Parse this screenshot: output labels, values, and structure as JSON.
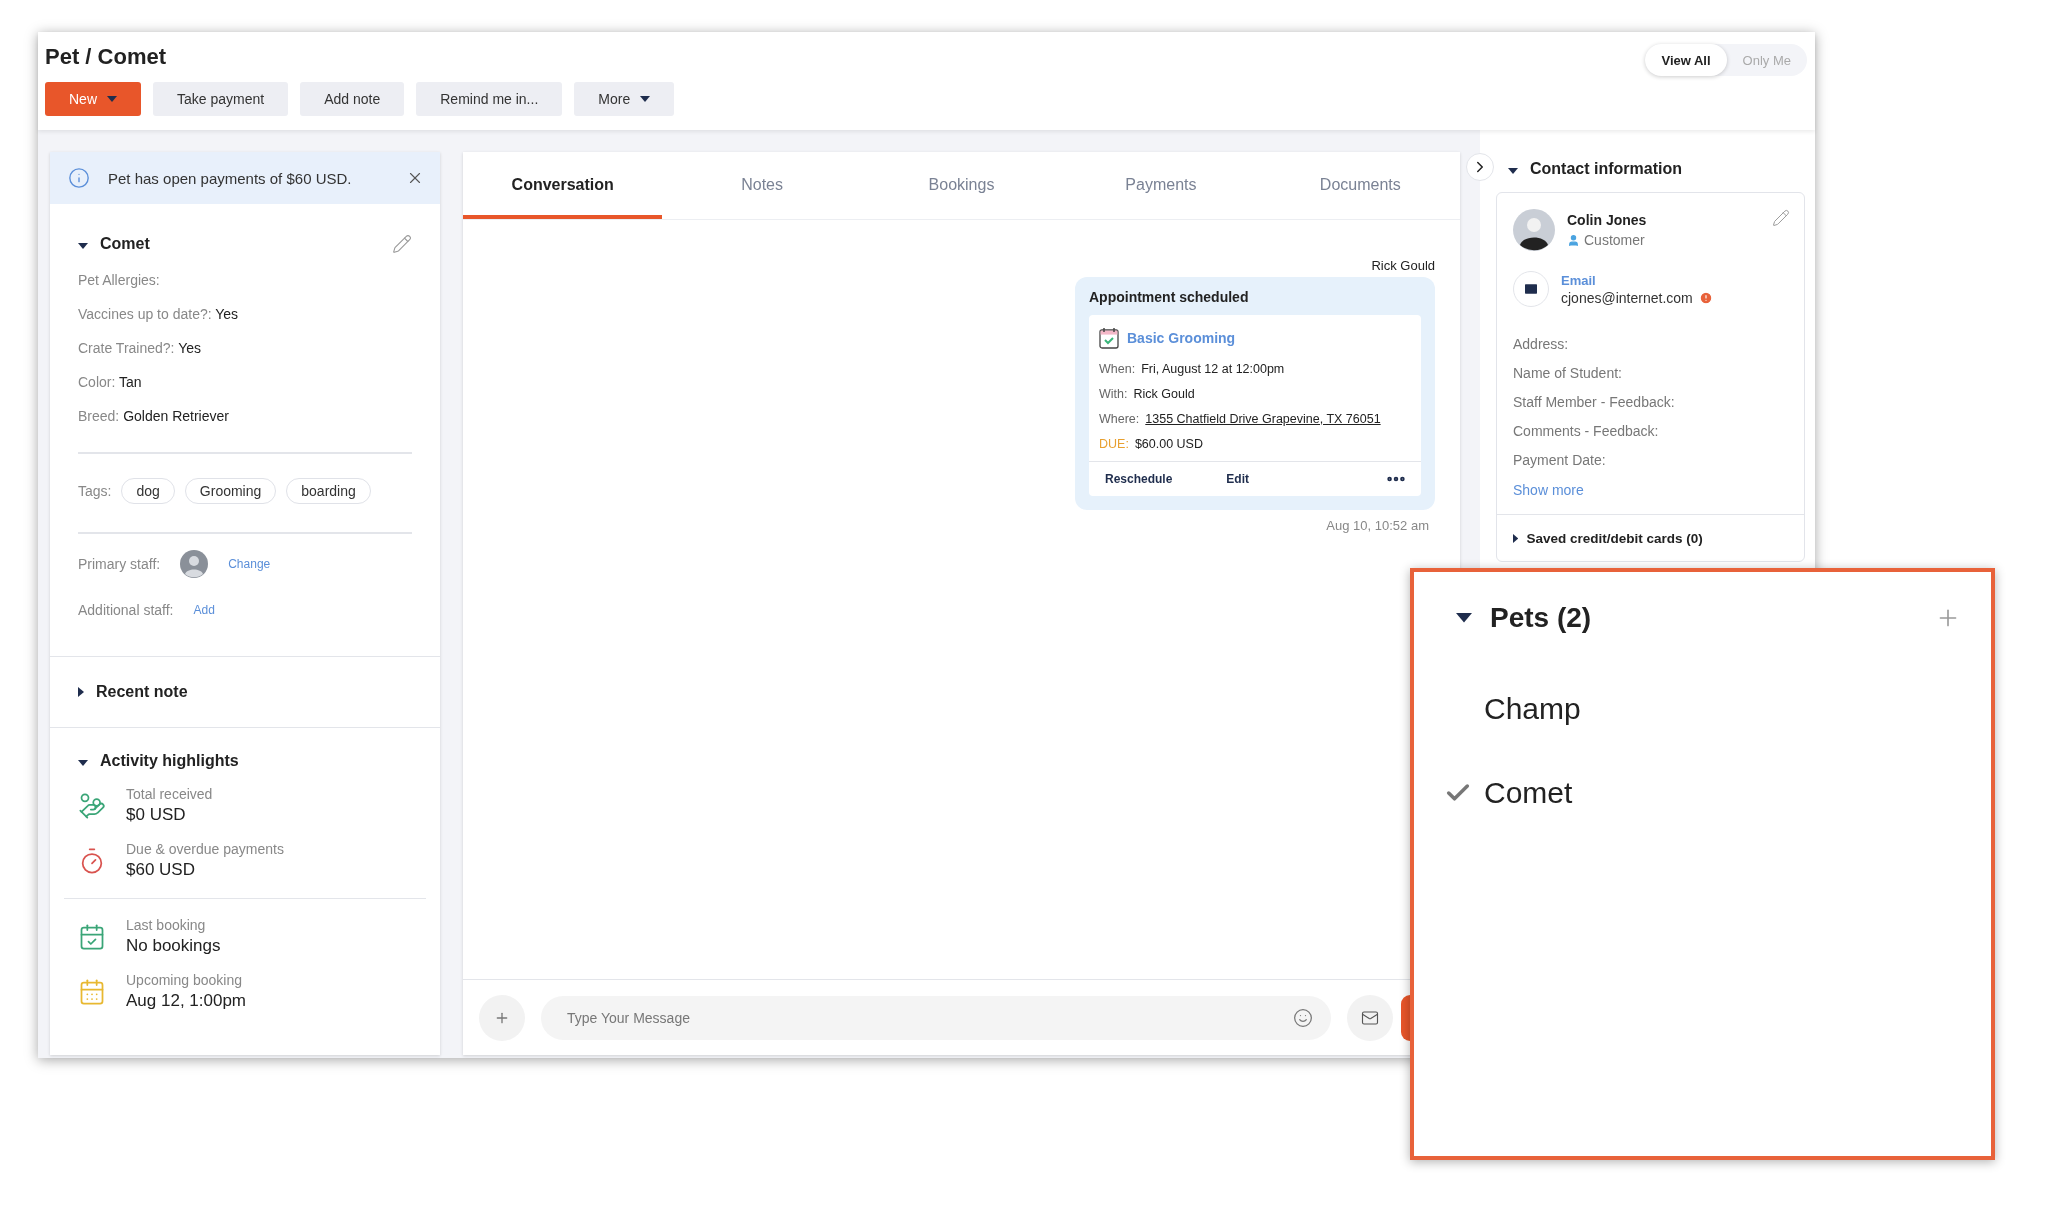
{
  "header": {
    "title": "Pet / Comet",
    "actions": [
      {
        "label": "New",
        "kind": "primary",
        "dropdown": true
      },
      {
        "label": "Take payment",
        "kind": "secondary",
        "dropdown": false
      },
      {
        "label": "Add note",
        "kind": "secondary",
        "dropdown": false
      },
      {
        "label": "Remind me in...",
        "kind": "secondary",
        "dropdown": false
      },
      {
        "label": "More",
        "kind": "secondary",
        "dropdown": true
      }
    ],
    "view_toggle": [
      {
        "label": "View All",
        "selected": true
      },
      {
        "label": "Only Me",
        "selected": false
      }
    ]
  },
  "alert": {
    "text": "Pet has open payments of $60 USD."
  },
  "pet": {
    "name": "Comet",
    "expanded": true,
    "fields": [
      {
        "label": "Pet Allergies:"
      },
      {
        "label": "Vaccines up to date?:",
        "value": "Yes"
      },
      {
        "label": "Crate Trained?:",
        "value": "Yes"
      },
      {
        "label": "Color:",
        "value": "Tan"
      },
      {
        "label": "Breed:",
        "value": "Golden Retriever"
      }
    ]
  },
  "tags": {
    "label": "Tags:",
    "items": [
      "dog",
      "Grooming",
      "boarding"
    ]
  },
  "staff": [
    {
      "label": "Primary staff:",
      "has_avatar": true,
      "action": "Change"
    },
    {
      "label": "Additional staff:",
      "has_avatar": false,
      "action": "Add"
    }
  ],
  "recent_note": {
    "title": "Recent note",
    "expanded": false
  },
  "activity": {
    "title": "Activity highlights",
    "expanded": true,
    "groups": [
      [
        {
          "kind": "received",
          "label": "Total received",
          "value": "$0 USD"
        },
        {
          "kind": "due",
          "label": "Due & overdue payments",
          "value": "$60 USD"
        }
      ],
      [
        {
          "kind": "last_booking",
          "label": "Last booking",
          "value": "No bookings"
        },
        {
          "kind": "upcoming",
          "label": "Upcoming booking",
          "value": "Aug 12, 1:00pm"
        }
      ]
    ]
  },
  "tabs": [
    {
      "label": "Conversation",
      "selected": true
    },
    {
      "label": "Notes",
      "selected": false
    },
    {
      "label": "Bookings",
      "selected": false
    },
    {
      "label": "Payments",
      "selected": false
    },
    {
      "label": "Documents",
      "selected": false
    }
  ],
  "conversation": {
    "sender": "Rick Gould",
    "title": "Appointment scheduled",
    "service": "Basic Grooming",
    "details": [
      {
        "kind": "plain",
        "label": "When:",
        "value": "Fri, August 12 at 12:00pm"
      },
      {
        "kind": "plain",
        "label": "With:",
        "value": "Rick Gould"
      },
      {
        "kind": "link",
        "label": "Where:",
        "value": "1355 Chatfield Drive Grapevine, TX 76051"
      },
      {
        "kind": "due",
        "label": "DUE:",
        "value": "$60.00 USD"
      }
    ],
    "actions": [
      "Reschedule",
      "Edit"
    ],
    "time": "Aug 10, 10:52 am"
  },
  "composer": {
    "placeholder": "Type Your Message"
  },
  "contact": {
    "title": "Contact information",
    "expanded": true,
    "name": "Colin Jones",
    "role": "Customer",
    "email_label": "Email",
    "email": "cjones@internet.com",
    "email_warning": true,
    "fields": [
      "Address:",
      "Name of Student:",
      "Staff Member - Feedback:",
      "Comments - Feedback:",
      "Payment Date:"
    ],
    "show_more": "Show more"
  },
  "saved_cards": {
    "title": "Saved credit/debit cards (0)",
    "expanded": false
  },
  "pets_callout": {
    "title": "Pets (2)",
    "expanded": true,
    "items": [
      {
        "name": "Champ",
        "selected": false
      },
      {
        "name": "Comet",
        "selected": true
      }
    ]
  }
}
